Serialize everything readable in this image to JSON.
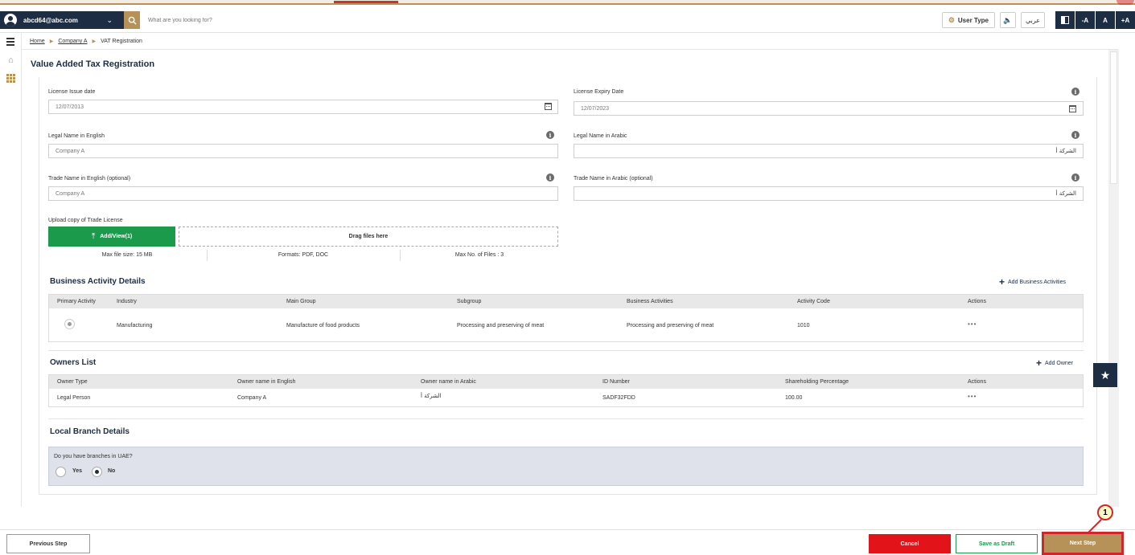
{
  "header": {
    "user_email": "abcd64@abc.com",
    "search_placeholder": "What are you looking for?",
    "user_type_label": "User Type",
    "language_label": "عربي",
    "font_decrease": "-A",
    "font_normal": "A",
    "font_increase": "+A"
  },
  "breadcrumb": {
    "items": [
      "Home",
      "Company A",
      "VAT Registration"
    ]
  },
  "page": {
    "title": "Value Added Tax Registration"
  },
  "form": {
    "license_issue_date": {
      "label": "License Issue date",
      "value": "12/07/2013"
    },
    "license_expiry_date": {
      "label": "License Expiry Date",
      "value": "12/07/2023"
    },
    "legal_name_en": {
      "label": "Legal Name in English",
      "placeholder": "Company A"
    },
    "legal_name_ar": {
      "label": "Legal Name in Arabic",
      "value": "الشركة أ"
    },
    "trade_name_en": {
      "label": "Trade Name in English (optional)",
      "placeholder": "Company A"
    },
    "trade_name_ar": {
      "label": "Trade Name in Arabic (optional)",
      "value": "الشركة أ"
    }
  },
  "upload": {
    "label": "Upload copy of Trade License",
    "button_label": "Add/View(1)",
    "dropzone_label": "Drag files here",
    "max_size": "Max file size: 15 MB",
    "formats": "Formats: PDF, DOC",
    "max_files": "Max No. of Files : 3"
  },
  "business_activities": {
    "title": "Business Activity Details",
    "add_label": "Add Business Activities",
    "columns": [
      "Primary Activity",
      "Industry",
      "Main Group",
      "Subgroup",
      "Business Activities",
      "Activity Code",
      "Actions"
    ],
    "rows": [
      {
        "industry": "Manufacturing",
        "main_group": "Manufacture of food products",
        "subgroup": "Processing and preserving of meat",
        "activity": "Processing and preserving of meat",
        "code": "1010",
        "actions": "•••"
      }
    ]
  },
  "owners": {
    "title": "Owners List",
    "add_label": "Add Owner",
    "columns": [
      "Owner Type",
      "Owner name in English",
      "Owner name in Arabic",
      "ID Number",
      "Shareholding Percentage",
      "Actions"
    ],
    "rows": [
      {
        "type": "Legal Person",
        "name_en": "Company A",
        "name_ar": "الشركة أ",
        "id_number": "SADF32FDD",
        "share": "100.00",
        "actions": "•••"
      }
    ]
  },
  "branches": {
    "title": "Local Branch Details",
    "question": "Do you have branches in UAE?",
    "options": [
      "Yes",
      "No"
    ],
    "selected": "No"
  },
  "footer": {
    "previous": "Previous Step",
    "cancel": "Cancel",
    "save_draft": "Save as Draft",
    "next": "Next Step",
    "step_marker": "1"
  },
  "colors": {
    "navy": "#1d2d44",
    "gold": "#b69259",
    "green": "#1c9a4b",
    "red": "#e3131a"
  }
}
